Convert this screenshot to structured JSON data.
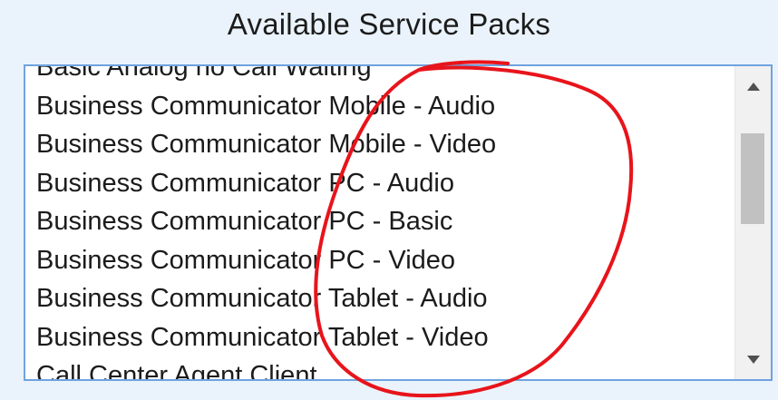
{
  "header": {
    "title": "Available Service Packs"
  },
  "service_pack_list": {
    "items": [
      "Basic Analog no Call Waiting",
      "Business Communicator Mobile - Audio",
      "Business Communicator Mobile - Video",
      "Business Communicator PC - Audio",
      "Business Communicator PC - Basic",
      "Business Communicator PC - Video",
      "Business Communicator Tablet - Audio",
      "Business Communicator Tablet - Video",
      "Call Center Agent Client"
    ]
  },
  "scrollbar": {
    "up_icon": "triangle-up-icon",
    "down_icon": "triangle-down-icon"
  },
  "colors": {
    "background": "#eaf3fb",
    "list_border": "#6fa3df",
    "annotation_stroke": "#e8141b"
  }
}
